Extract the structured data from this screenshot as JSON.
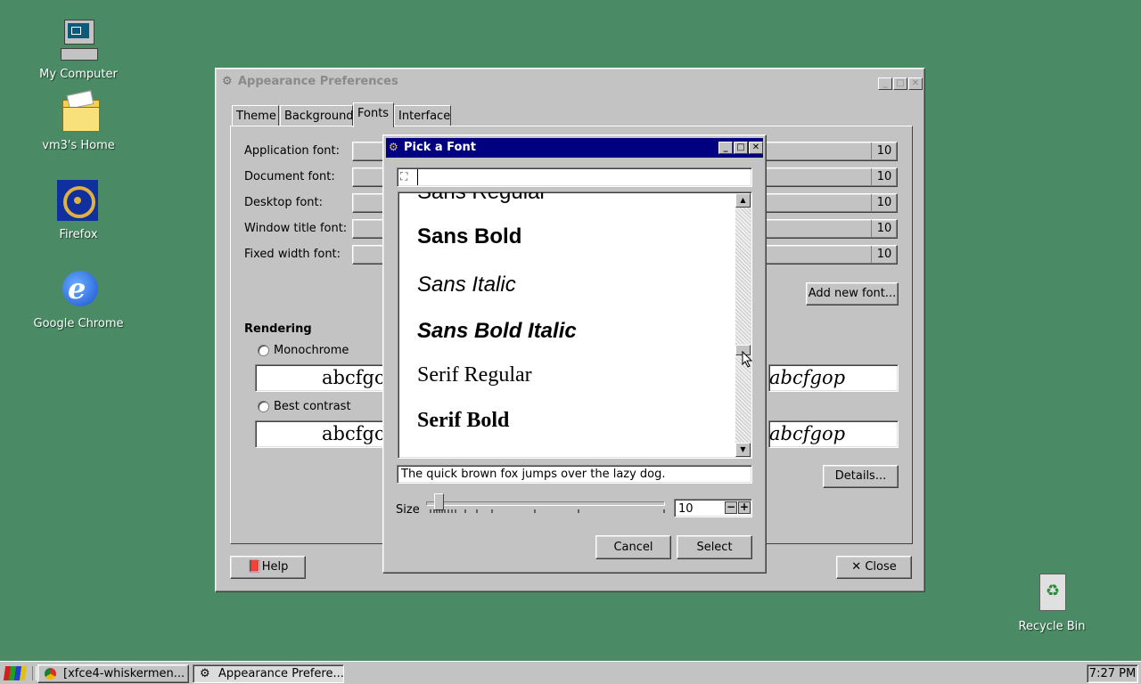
{
  "desktop": {
    "icons": [
      {
        "label": "My Computer",
        "icon": "computer-icon"
      },
      {
        "label": "vm3's Home",
        "icon": "folder-icon"
      },
      {
        "label": "Firefox",
        "icon": "ship-wheel-icon"
      },
      {
        "label": "Google Chrome",
        "icon": "ie-icon"
      },
      {
        "label": "Recycle Bin",
        "icon": "recycle-bin-icon"
      }
    ]
  },
  "prefs_window": {
    "title": "Appearance Preferences",
    "tabs": [
      "Theme",
      "Background",
      "Fonts",
      "Interface"
    ],
    "active_tab": "Fonts",
    "font_rows": [
      {
        "label": "Application font:",
        "size": "10"
      },
      {
        "label": "Document font:",
        "size": "10"
      },
      {
        "label": "Desktop font:",
        "size": "10"
      },
      {
        "label": "Window title font:",
        "size": "10"
      },
      {
        "label": "Fixed width font:",
        "size": "10"
      }
    ],
    "add_new_font_button": "Add new font...",
    "rendering_heading": "Rendering",
    "rendering_options": [
      {
        "label": "Monochrome",
        "preview_left": "abcfgop",
        "preview_right": "abcfgop"
      },
      {
        "label": "Best contrast",
        "preview_left": "abcfgop",
        "preview_right": "abcfgop"
      }
    ],
    "details_button": "Details...",
    "help_button": "Help",
    "close_button": "Close"
  },
  "pick_font_dialog": {
    "title": "Pick a Font",
    "search_value": "",
    "font_list": [
      "Sans Regular",
      "Sans Bold",
      "Sans Italic",
      "Sans Bold Italic",
      "Serif Regular",
      "Serif Bold"
    ],
    "preview_text": "The quick brown fox jumps over the lazy dog.",
    "size_label": "Size",
    "size_value": "10",
    "cancel_button": "Cancel",
    "select_button": "Select"
  },
  "taskbar": {
    "tasks": [
      "[xfce4-whiskermen...",
      "Appearance Prefere..."
    ],
    "clock": "7:27 PM"
  }
}
